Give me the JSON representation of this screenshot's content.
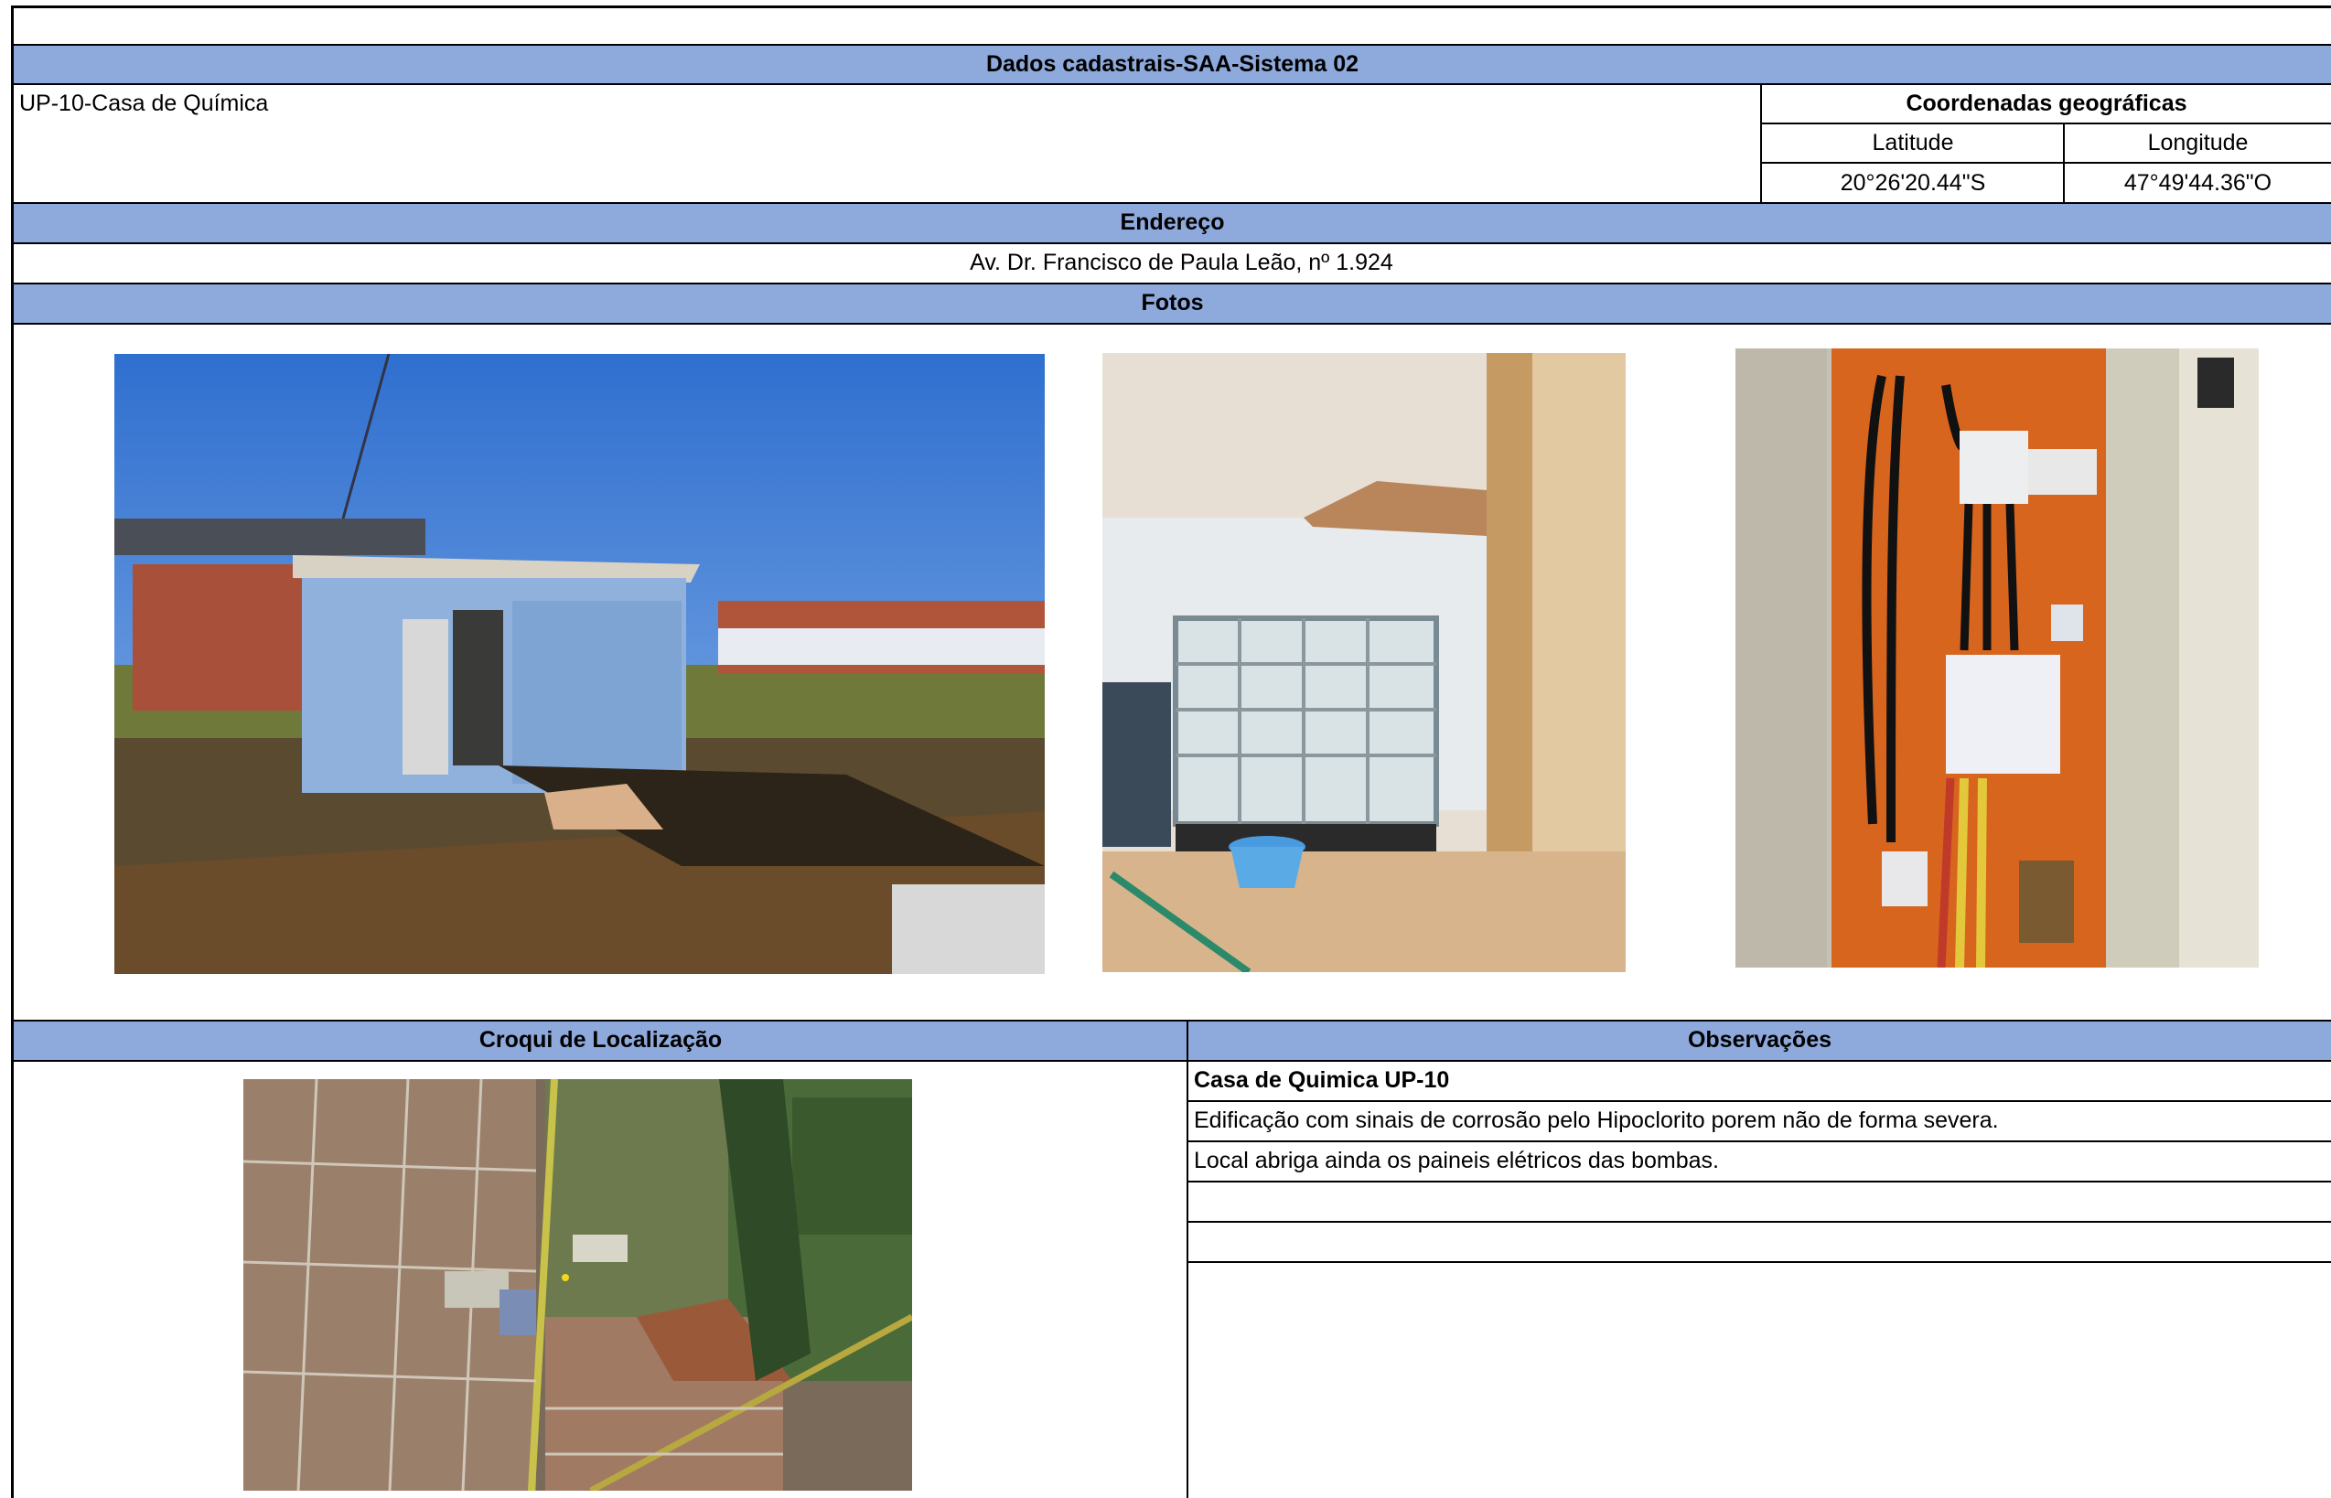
{
  "sheet": {
    "title": "Dados cadastrais-SAA-Sistema 02",
    "unit_name": "UP-10-Casa de Química",
    "coordinates": {
      "header": "Coordenadas geográficas",
      "lat_label": "Latitude",
      "lon_label": "Longitude",
      "lat_value": "20°26'20.44\"S",
      "lon_value": "47°49'44.36\"O"
    },
    "address": {
      "header": "Endereço",
      "value": "Av. Dr. Francisco de Paula Leão, nº 1.924"
    },
    "photos": {
      "header": "Fotos",
      "items": [
        "building-exterior-photo",
        "chemical-tank-photo",
        "electrical-panel-photo"
      ]
    },
    "map": {
      "header": "Croqui de Localização"
    },
    "observations": {
      "header": "Observações",
      "lines": [
        "Casa de Quimica UP-10",
        "Edificação com sinais de corrosão pelo Hipoclorito porem não de forma severa.",
        "Local abriga ainda os paineis elétricos das bombas.",
        "",
        ""
      ]
    }
  }
}
